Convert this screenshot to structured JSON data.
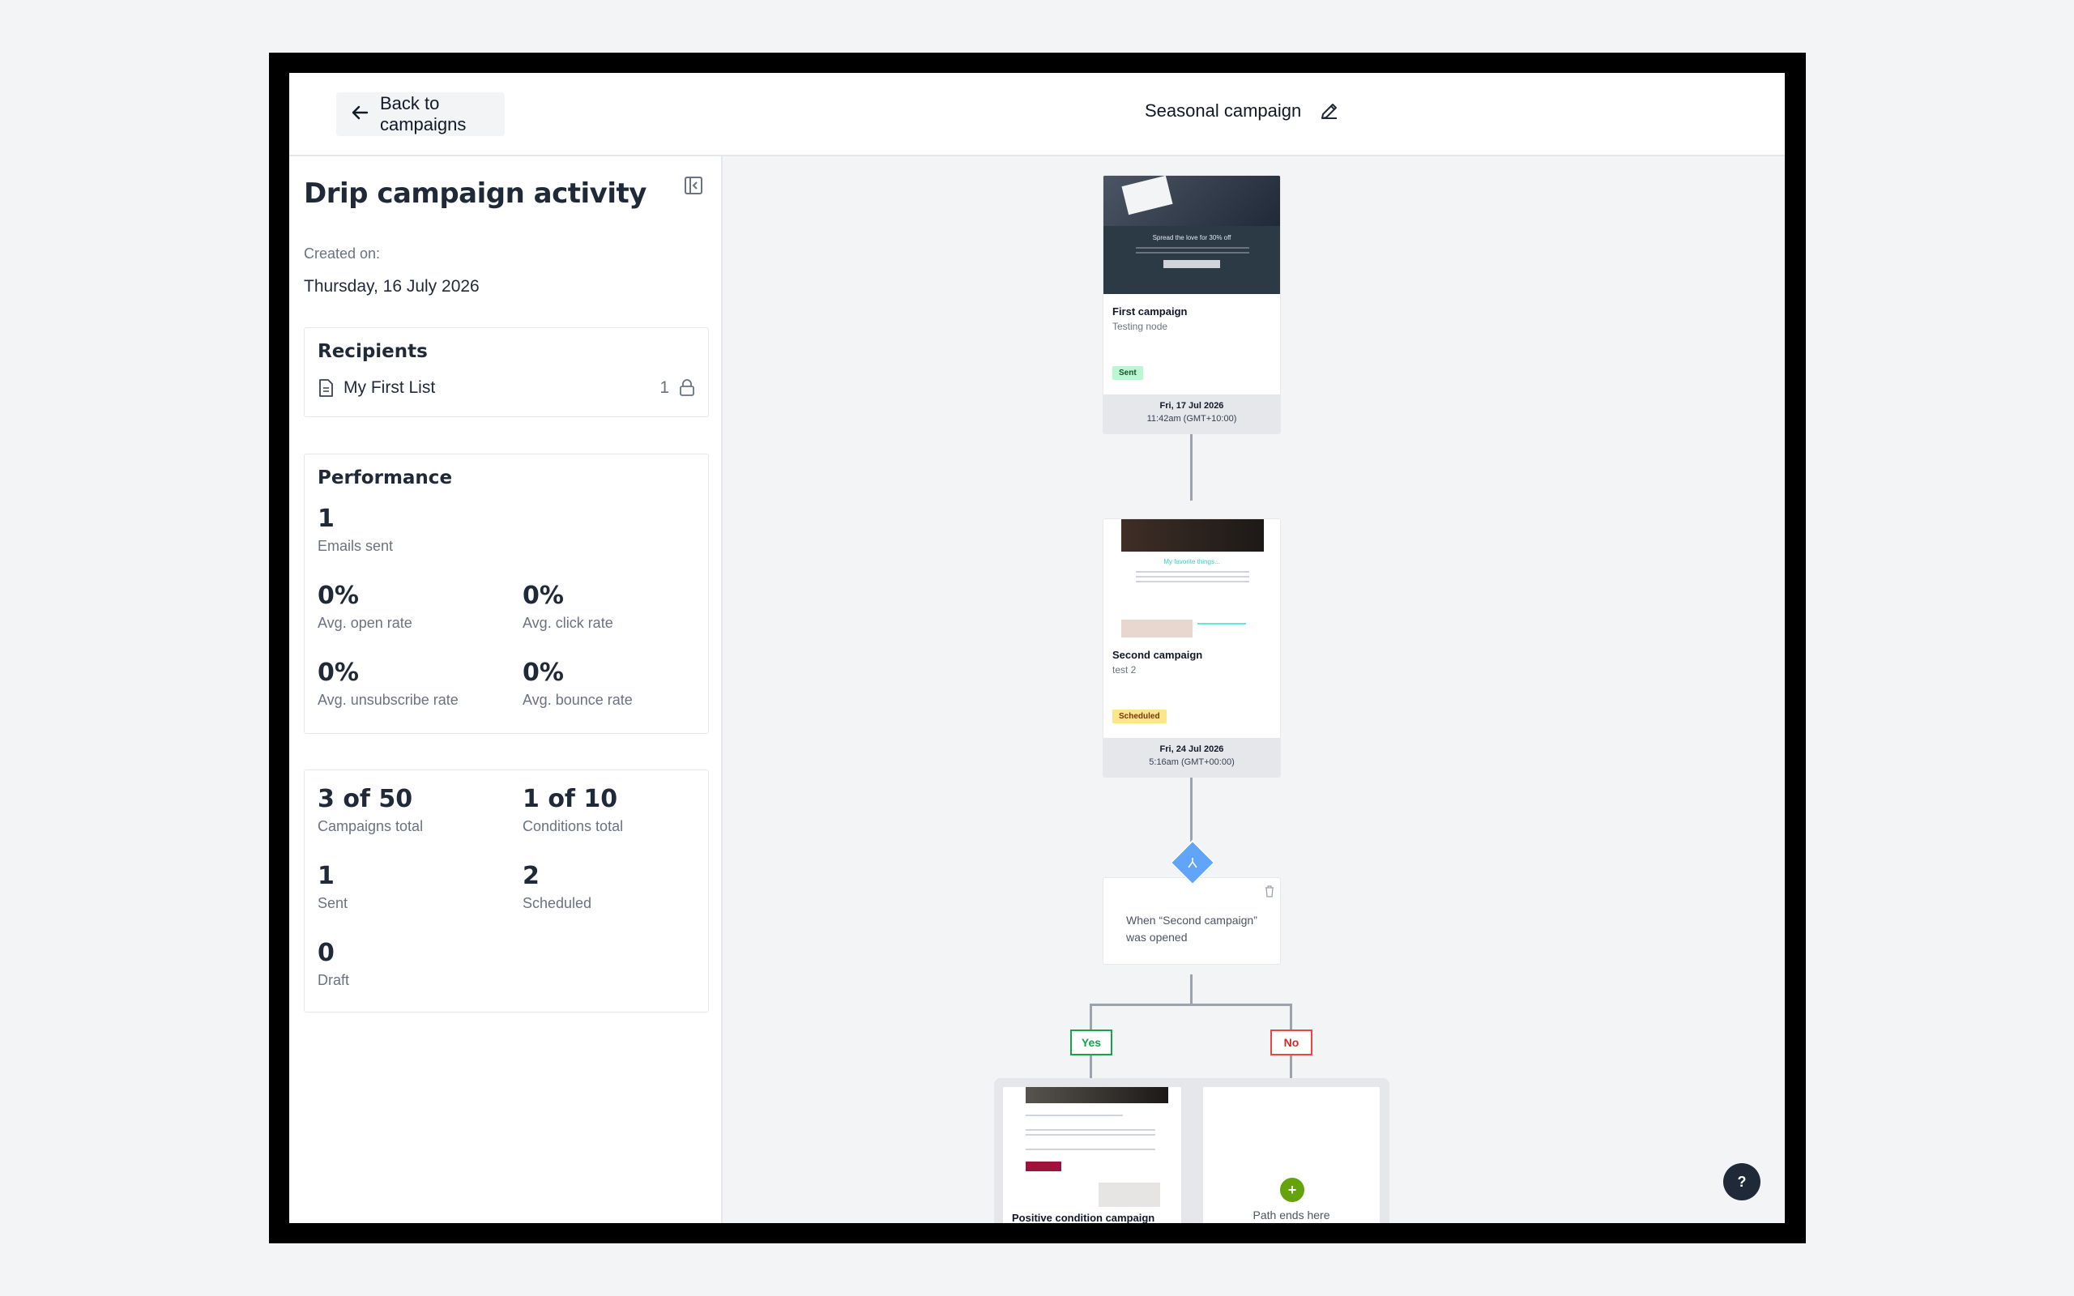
{
  "header": {
    "back_label": "Back to campaigns",
    "campaign_name": "Seasonal campaign"
  },
  "sidebar": {
    "title": "Drip campaign activity",
    "created_label": "Created on:",
    "created_date": "Thursday, 16 July 2026",
    "recipients": {
      "title": "Recipients",
      "list_name": "My First List",
      "count": "1"
    },
    "performance": {
      "title": "Performance",
      "emails_sent": {
        "value": "1",
        "label": "Emails sent"
      },
      "open_rate": {
        "value": "0%",
        "label": "Avg. open rate"
      },
      "click_rate": {
        "value": "0%",
        "label": "Avg. click rate"
      },
      "unsubscribe_rate": {
        "value": "0%",
        "label": "Avg. unsubscribe rate"
      },
      "bounce_rate": {
        "value": "0%",
        "label": "Avg. bounce rate"
      }
    },
    "totals": {
      "campaigns": {
        "value": "3 of 50",
        "label": "Campaigns total"
      },
      "conditions": {
        "value": "1 of 10",
        "label": "Conditions total"
      },
      "sent": {
        "value": "1",
        "label": "Sent"
      },
      "scheduled": {
        "value": "2",
        "label": "Scheduled"
      },
      "draft": {
        "value": "0",
        "label": "Draft"
      }
    }
  },
  "flow": {
    "node1": {
      "thumb_headline": "Spread the love for 30% off",
      "name": "First campaign",
      "sub": "Testing node",
      "status": "Sent",
      "date": "Fri, 17 Jul 2026",
      "time": "11:42am (GMT+10:00)"
    },
    "node2": {
      "thumb_headline": "My favorite things...",
      "name": "Second campaign",
      "sub": "test 2",
      "status": "Scheduled",
      "date": "Fri, 24 Jul 2026",
      "time": "5:16am (GMT+00:00)"
    },
    "condition": {
      "text": "When “Second campaign” was opened"
    },
    "yes_label": "Yes",
    "no_label": "No",
    "positive_node": {
      "name": "Positive condition campaign"
    },
    "path_end_label": "Path ends here"
  },
  "help_label": "?",
  "colors": {
    "sent_badge_bg": "#bbf7d0",
    "scheduled_badge_bg": "#fde68a",
    "condition_diamond": "#60a5fa",
    "yes_color": "#16a34a",
    "no_color": "#dc2626",
    "add_color": "#65a30d"
  }
}
